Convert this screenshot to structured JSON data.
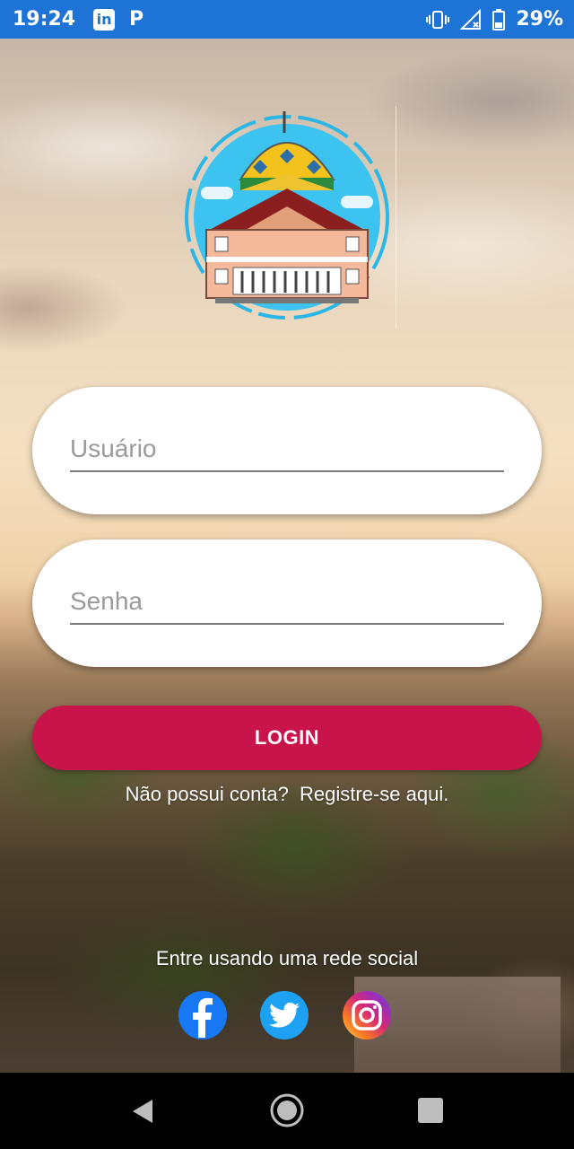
{
  "status_bar": {
    "time": "19:24",
    "linkedin_icon": "linkedin-icon",
    "p_icon_text": "P",
    "battery": "29%"
  },
  "form": {
    "username_placeholder": "Usuário",
    "password_placeholder": "Senha",
    "login_label": "LOGIN"
  },
  "register": {
    "prompt": "Não possui conta?",
    "link": "Registre-se aqui."
  },
  "social": {
    "label": "Entre usando uma rede social",
    "networks": [
      "facebook-icon",
      "twitter-icon",
      "instagram-icon"
    ]
  },
  "colors": {
    "status_bar": "#1e74d6",
    "login_button": "#c9144b"
  }
}
